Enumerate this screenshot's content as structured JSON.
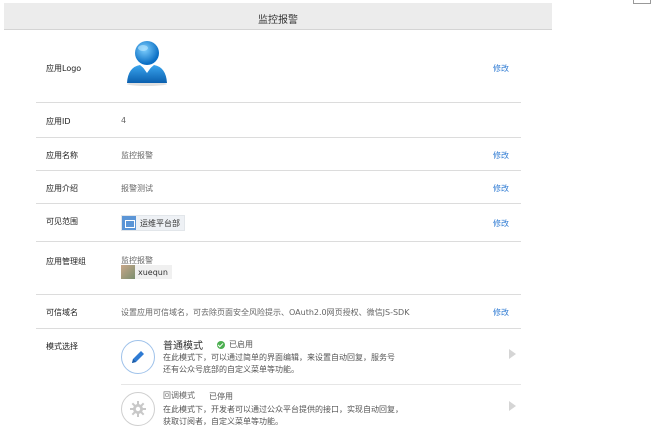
{
  "header": {
    "title": "监控报警"
  },
  "rows": {
    "logo": {
      "label": "应用Logo",
      "edit": "修改"
    },
    "id": {
      "label": "应用ID",
      "value": "4"
    },
    "name": {
      "label": "应用名称",
      "value": "监控报警",
      "edit": "修改"
    },
    "intro": {
      "label": "应用介绍",
      "value": "报警测试",
      "edit": "修改"
    },
    "scope": {
      "label": "可见范围",
      "department": "运维平台部",
      "edit": "修改"
    },
    "admins": {
      "label": "应用管理组",
      "group": "监控报警",
      "member": "xuequn"
    },
    "domain": {
      "label": "可信域名",
      "value": "设置应用可信域名，可去除页面安全风险提示、OAuth2.0网页授权、微信JS-SDK",
      "edit": "修改"
    },
    "mode": {
      "label": "模式选择",
      "normal": {
        "title": "普通模式",
        "status": "已启用",
        "desc1": "在此模式下，可以通过简单的界面编辑，来设置自动回复，服务号",
        "desc2": "还有公众号底部的自定义菜单等功能。"
      },
      "callback": {
        "title": "回调模式",
        "status": "已停用",
        "desc1": "在此模式下，开发者可以通过公众平台提供的接口，实现自动回复，",
        "desc2": "获取订阅者，自定义菜单等功能。"
      }
    }
  },
  "colors": {
    "link": "#2f7bd3",
    "enabled": "#4caf50"
  },
  "icons": {
    "avatar": "person-avatar-icon",
    "department": "folder-icon",
    "normal_mode": "pencil-icon",
    "callback_mode": "gear-icon",
    "arrow": "chevron-right-icon"
  }
}
